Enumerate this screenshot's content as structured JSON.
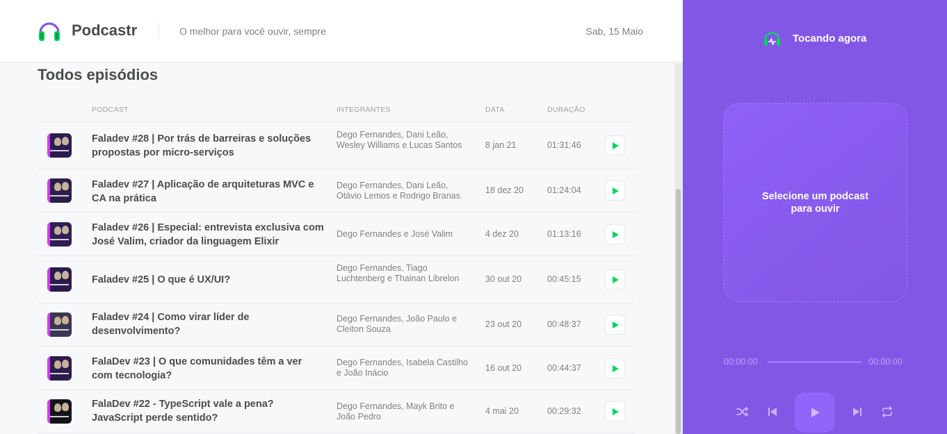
{
  "header": {
    "app_name": "Podcastr",
    "tagline": "O melhor para você ouvir, sempre",
    "date": "Sab, 15 Maio"
  },
  "episodes": {
    "title": "Todos episódios",
    "columns": [
      "PODCAST",
      "INTEGRANTES",
      "DATA",
      "DURAÇÃO"
    ],
    "rows": [
      {
        "title": "Faladev #28 | Por trás de barreiras e soluções propostas por micro-serviços",
        "members": "Dego Fernandes, Dani Leão, Wesley Williams e Lucas Santos",
        "date": "8 jan 21",
        "duration": "01:31:46",
        "thumb_color": "#2a1d4f"
      },
      {
        "title": "Faladev #27 | Aplicação de arquiteturas MVC e CA na prática",
        "members": "Dego Fernandes, Dani Leão, Otávio Lemos e Rodrigo Branas",
        "date": "18 dez 20",
        "duration": "01:24:04",
        "thumb_color": "#2b1f4a"
      },
      {
        "title": "Faladev #26 | Especial: entrevista exclusiva com José Valim, criador da linguagem Elixir",
        "members": "Dego Fernandes e José Valim",
        "date": "4 dez 20",
        "duration": "01:13:16",
        "thumb_color": "#301e55"
      },
      {
        "title": "Faladev #25 | O que é UX/UI?",
        "members": "Dego Fernandes, Tiago Luchtenberg e Thainan Librelon",
        "date": "30 out 20",
        "duration": "00:45:15",
        "thumb_color": "#2a1b4d"
      },
      {
        "title": "Faladev #24 | Como virar líder de desenvolvimento?",
        "members": "Dego Fernandes, João Paulo e Cleiton Souza",
        "date": "23 out 20",
        "duration": "00:48:37",
        "thumb_color": "#3a3550"
      },
      {
        "title": "FalaDev #23 | O que comunidades têm a ver com tecnologia?",
        "members": "Dego Fernandes, Isabela Castilho e João Inácio",
        "date": "16 out 20",
        "duration": "00:44:37",
        "thumb_color": "#2d1c4c"
      },
      {
        "title": "FalaDev #22 - TypeScript vale a pena? JavaScript perde sentido?",
        "members": "Dego Fernandes, Mayk Brito e João Pedro",
        "date": "4 mai 20",
        "duration": "00:29:32",
        "thumb_color": "#15121c"
      }
    ]
  },
  "player": {
    "now_playing_label": "Tocando agora",
    "empty_message": "Selecione um podcast para ouvir",
    "current_time": "00:00:00",
    "total_time": "00:00:00",
    "controls": [
      "shuffle-icon",
      "previous-icon",
      "play-icon",
      "next-icon",
      "repeat-icon"
    ],
    "accent_color": "#8257e5",
    "play_color": "#04d361"
  }
}
